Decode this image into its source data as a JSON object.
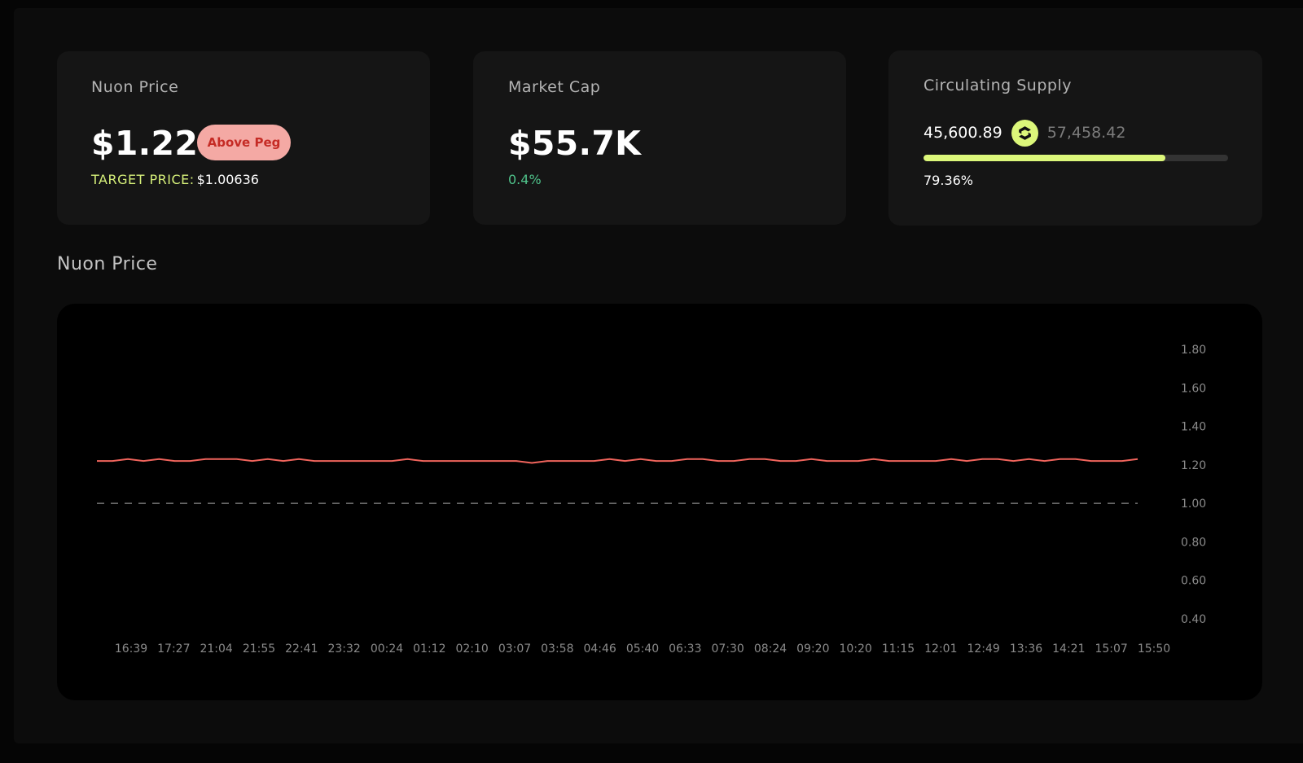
{
  "cards": {
    "price": {
      "title": "Nuon Price",
      "value": "$1.22",
      "badge": "Above Peg",
      "target_label": "TARGET PRICE:",
      "target_value": "$1.00636"
    },
    "market_cap": {
      "title": "Market Cap",
      "value": "$55.7K",
      "change": "0.4%"
    },
    "supply": {
      "title": "Circulating Supply",
      "current": "45,600.89",
      "max": "57,458.42",
      "percent_text": "79.36%",
      "progress": 0.7936,
      "icon": "nuon-coin-icon"
    }
  },
  "colors": {
    "accent_lime": "#dcf77a",
    "badge_bg": "#f4a9a4",
    "badge_text": "#c52b25",
    "positive_green": "#4fc28a",
    "price_line": "#f0645c"
  },
  "chart_section_title": "Nuon Price",
  "chart_data": {
    "type": "line",
    "title": "",
    "xlabel": "",
    "ylabel": "",
    "ylim": [
      0.4,
      1.8
    ],
    "y_ticks": [
      "1.80",
      "1.60",
      "1.40",
      "1.20",
      "1.00",
      "0.80",
      "0.60",
      "0.40"
    ],
    "y_tick_values": [
      1.8,
      1.6,
      1.4,
      1.2,
      1.0,
      0.8,
      0.6,
      0.4
    ],
    "x_ticks": [
      "16:39",
      "17:27",
      "21:04",
      "21:55",
      "22:41",
      "23:32",
      "00:24",
      "01:12",
      "02:10",
      "03:07",
      "03:58",
      "04:46",
      "05:40",
      "06:33",
      "07:30",
      "08:24",
      "09:20",
      "10:20",
      "11:15",
      "12:01",
      "12:49",
      "13:36",
      "14:21",
      "15:07",
      "15:50"
    ],
    "axis_position": "right",
    "grid": false,
    "peg_line": 1.0,
    "series": [
      {
        "values": [
          1.22,
          1.22,
          1.23,
          1.22,
          1.23,
          1.22,
          1.22,
          1.23,
          1.23,
          1.23,
          1.22,
          1.23,
          1.22,
          1.23,
          1.22,
          1.22,
          1.22,
          1.22,
          1.22,
          1.22,
          1.23,
          1.22,
          1.22,
          1.22,
          1.22,
          1.22,
          1.22,
          1.22,
          1.21,
          1.22,
          1.22,
          1.22,
          1.22,
          1.23,
          1.22,
          1.23,
          1.22,
          1.22,
          1.23,
          1.23,
          1.22,
          1.22,
          1.23,
          1.23,
          1.22,
          1.22,
          1.23,
          1.22,
          1.22,
          1.22,
          1.23,
          1.22,
          1.22,
          1.22,
          1.22,
          1.23,
          1.22,
          1.23,
          1.23,
          1.22,
          1.23,
          1.22,
          1.23,
          1.23,
          1.22,
          1.22,
          1.22,
          1.23
        ]
      }
    ]
  }
}
